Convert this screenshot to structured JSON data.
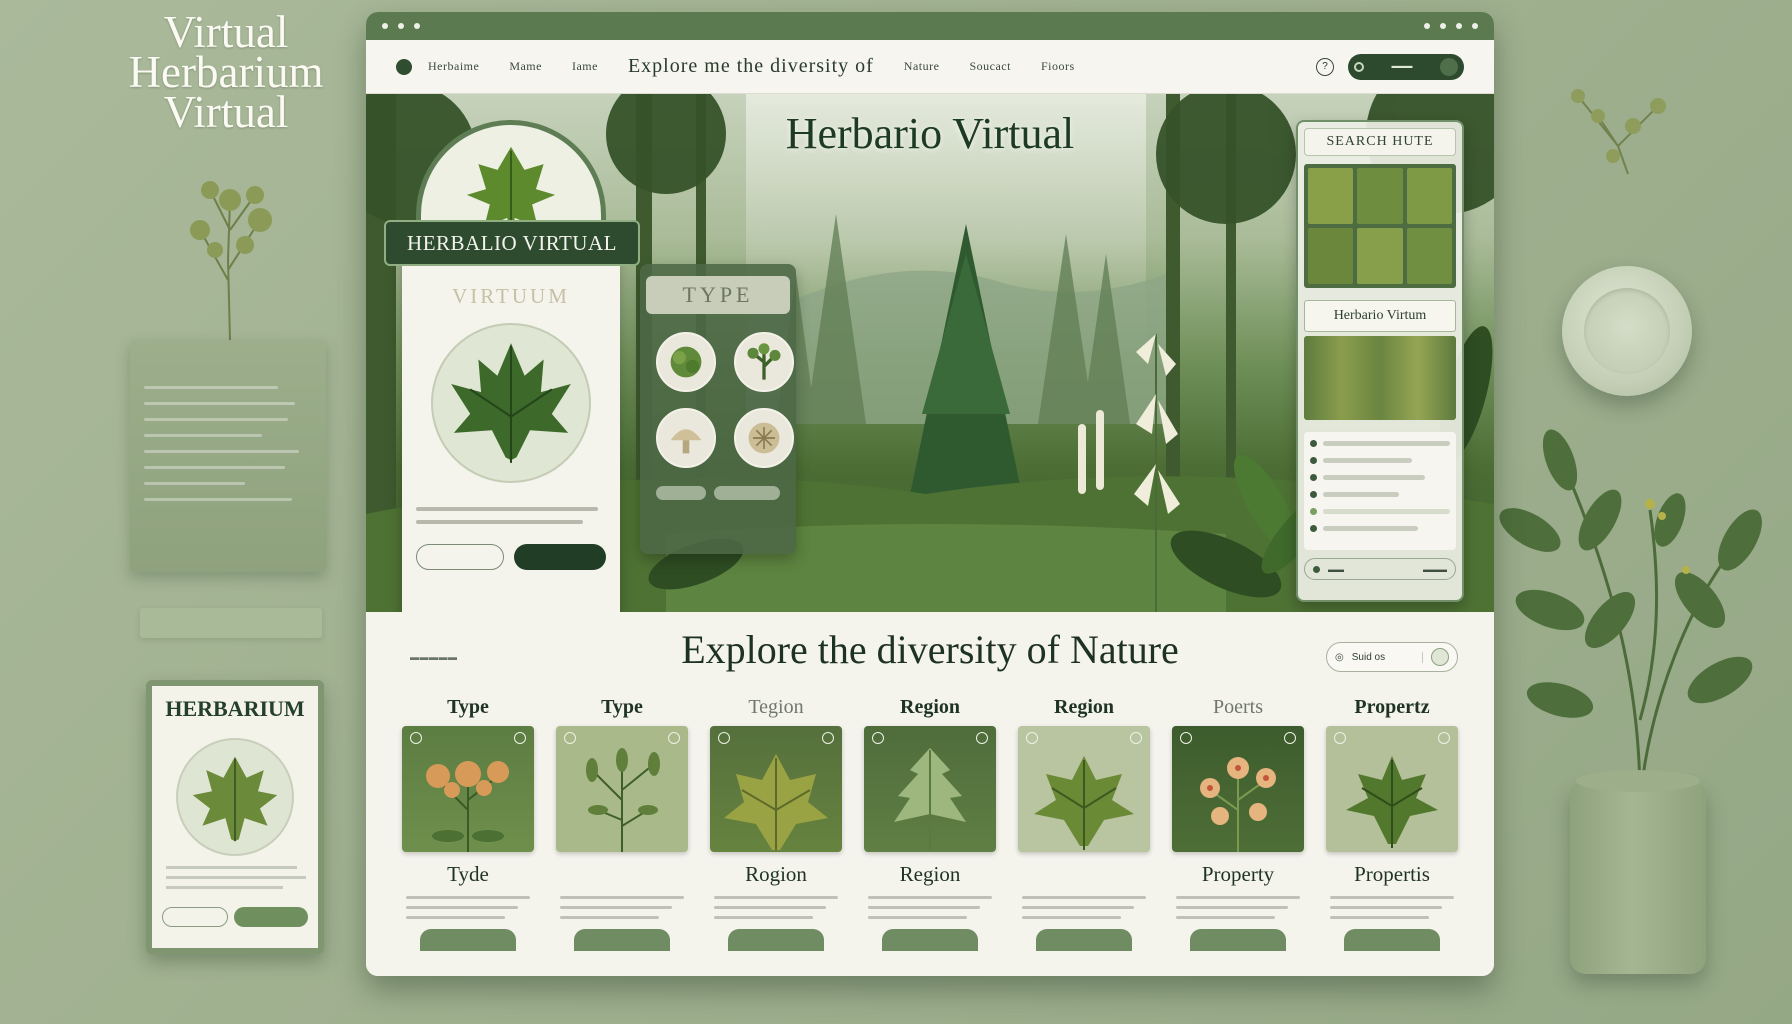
{
  "backdrop": {
    "title_lines": [
      "Virtual",
      "Herbarium",
      "Virtual"
    ],
    "card_title": "HERBARIUM"
  },
  "window": {
    "nav": {
      "items": [
        "Herbaime",
        "Mame",
        "Iame"
      ],
      "hero_text": "Explore me the diversity of",
      "items_right": [
        "Nature",
        "Soucact",
        "Fioors"
      ],
      "help_glyph": "?"
    },
    "hero": {
      "title": "Herbario Virtual",
      "left_panel": {
        "banner": "HERBALIO VIRTUAL",
        "subtitle": "VIRTUUM"
      },
      "type_panel": {
        "heading": "TYPE"
      },
      "search_panel": {
        "heading": "SEARCH HUTE",
        "mid_label": "Herbario Virtum"
      }
    },
    "content": {
      "title": "Explore the diversity of Nature",
      "search_label": "Suid os",
      "categories": [
        {
          "label": "Type",
          "caption": "Tyde",
          "faint_label": false,
          "faint_caption": false,
          "image": "flower"
        },
        {
          "label": "Type",
          "caption": "",
          "faint_label": false,
          "faint_caption": true,
          "image": "herb"
        },
        {
          "label": "Tegion",
          "caption": "Rogion",
          "faint_label": true,
          "faint_caption": false,
          "image": "leaf"
        },
        {
          "label": "Region",
          "caption": "Region",
          "faint_label": false,
          "faint_caption": false,
          "image": "fern"
        },
        {
          "label": "Region",
          "caption": "",
          "faint_label": false,
          "faint_caption": true,
          "image": "leaf"
        },
        {
          "label": "Poerts",
          "caption": "Property",
          "faint_label": true,
          "faint_caption": false,
          "image": "flower2"
        },
        {
          "label": "Propertz",
          "caption": "Propertis",
          "faint_label": false,
          "faint_caption": false,
          "image": "leaf"
        }
      ]
    }
  },
  "colors": {
    "background": "#a9b99a",
    "accent_dark": "#2d4a2e",
    "panel": "#f4f3ec"
  }
}
